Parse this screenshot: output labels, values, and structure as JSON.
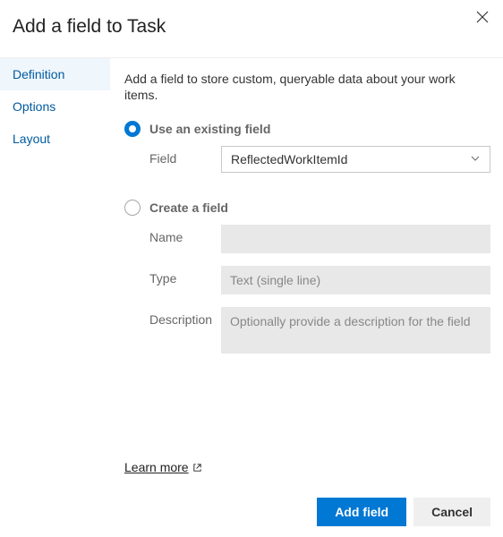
{
  "dialog": {
    "title": "Add a field to Task",
    "close_label": "Close"
  },
  "sidebar": {
    "items": [
      {
        "label": "Definition",
        "active": true
      },
      {
        "label": "Options",
        "active": false
      },
      {
        "label": "Layout",
        "active": false
      }
    ]
  },
  "panel": {
    "intro": "Add a field to store custom, queryable data about your work items.",
    "existing": {
      "radio_label": "Use an existing field",
      "field_label": "Field",
      "field_value": "ReflectedWorkItemId",
      "selected": true
    },
    "create": {
      "radio_label": "Create a field",
      "name_label": "Name",
      "name_value": "",
      "type_label": "Type",
      "type_value": "Text (single line)",
      "description_label": "Description",
      "description_placeholder": "Optionally provide a description for the field",
      "selected": false
    },
    "learn_more": "Learn more"
  },
  "footer": {
    "primary": "Add field",
    "secondary": "Cancel"
  }
}
